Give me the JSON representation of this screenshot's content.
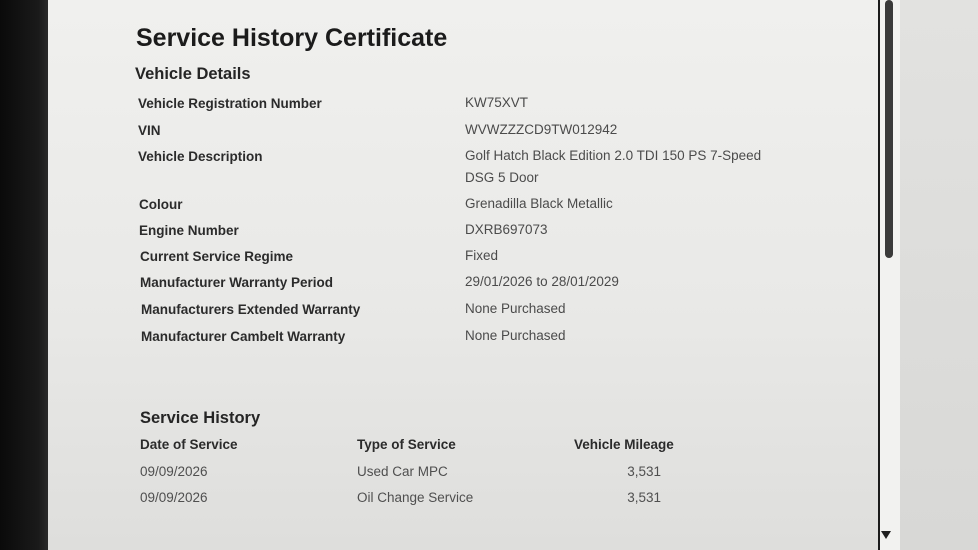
{
  "certificate": {
    "title": "Service History Certificate",
    "vehicle_details_heading": "Vehicle Details",
    "details": [
      {
        "label": "Vehicle Registration Number",
        "value": "KW75XVT"
      },
      {
        "label": "VIN",
        "value": "WVWZZZCD9TW012942"
      },
      {
        "label": "Vehicle Description",
        "value_line1": "Golf Hatch Black Edition 2.0 TDI 150 PS 7-Speed",
        "value_line2": "DSG 5 Door"
      },
      {
        "label": "Colour",
        "value": "Grenadilla Black Metallic"
      },
      {
        "label": "Engine Number",
        "value": "DXRB697073"
      },
      {
        "label": "Current Service Regime",
        "value": "Fixed"
      },
      {
        "label": "Manufacturer Warranty Period",
        "value": "29/01/2026 to 28/01/2029"
      },
      {
        "label": "Manufacturers Extended Warranty",
        "value": "None Purchased"
      },
      {
        "label": "Manufacturer Cambelt Warranty",
        "value": "None Purchased"
      }
    ],
    "service_history_heading": "Service History",
    "service_columns": [
      "Date of Service",
      "Type of Service",
      "Vehicle Mileage"
    ],
    "service_rows": [
      {
        "date": "09/09/2026",
        "type": "Used Car MPC",
        "mileage": "3,531"
      },
      {
        "date": "09/09/2026",
        "type": "Oil Change Service",
        "mileage": "3,531"
      }
    ]
  }
}
